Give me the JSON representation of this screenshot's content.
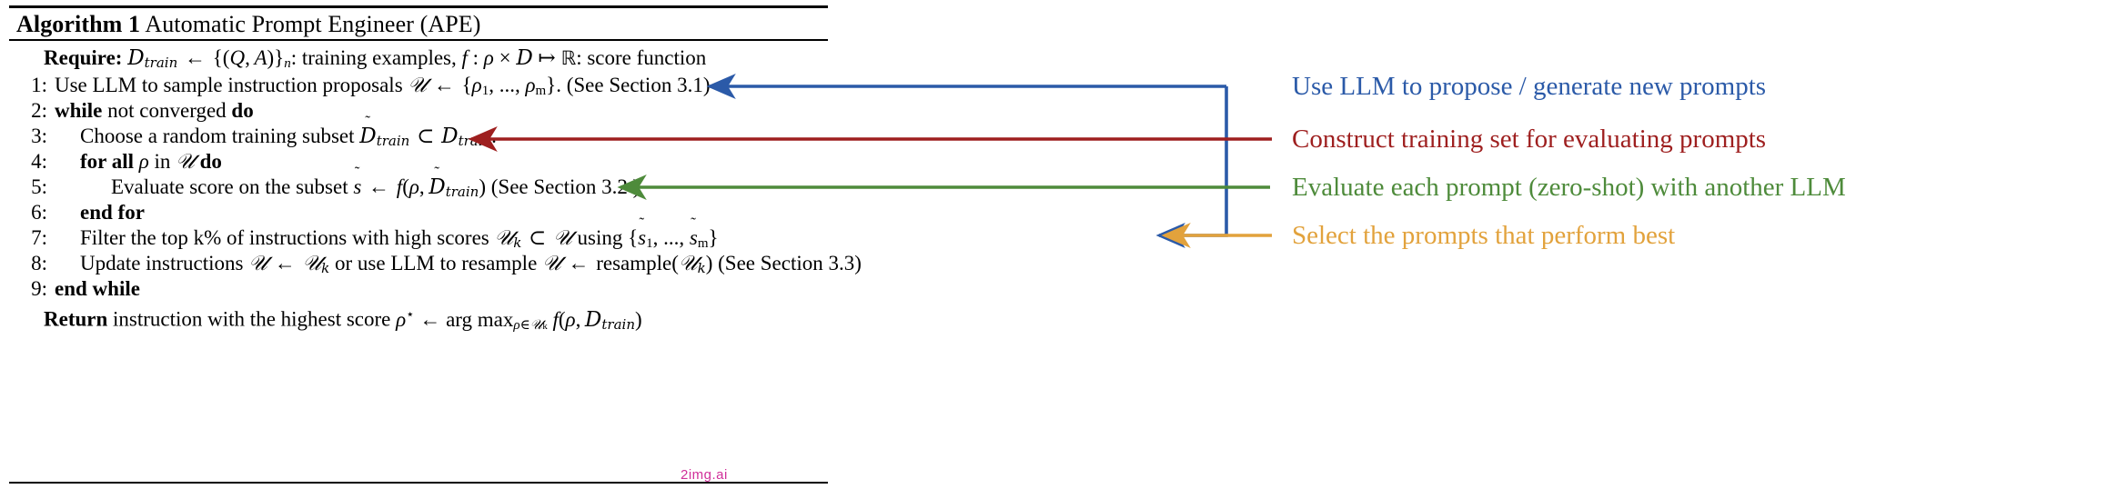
{
  "algorithm": {
    "title_prefix": "Algorithm 1",
    "title_text": "Automatic Prompt Engineer (APE)",
    "require_label": "Require:",
    "require_text_a": "training examples,",
    "require_text_b": ": score function",
    "require_sym_dtrain": "D",
    "require_sym_train_sub": "train",
    "require_arrow": "←",
    "require_set": "{(Q, A)}",
    "require_set_sub": "n",
    "require_colon": ":",
    "require_f": "f",
    "require_map": ": ρ ×",
    "require_D": "D",
    "require_mapsto": "↦",
    "require_R": "ℝ",
    "lines": [
      {
        "num": "1:",
        "indent": "i1",
        "text": "Use LLM to sample instruction proposals",
        "math": "U ← {ρ₁, ..., ρₘ}. (See Section 3.1)"
      },
      {
        "num": "2:",
        "indent": "i1",
        "text": "while not converged do",
        "math": ""
      },
      {
        "num": "3:",
        "indent": "i2",
        "text": "Choose a random training subset",
        "math": "D̃train ⊂ Dtrain."
      },
      {
        "num": "4:",
        "indent": "i2",
        "text": "for all ρ in U do",
        "math": ""
      },
      {
        "num": "5:",
        "indent": "i3",
        "text": "Evaluate score on the subset",
        "math": "s̃ ← f(ρ, D̃train) (See Section 3.2 )"
      },
      {
        "num": "6:",
        "indent": "i2",
        "text": "end for",
        "math": ""
      },
      {
        "num": "7:",
        "indent": "i2",
        "text": "Filter the top k% of instructions with high scores",
        "math": "Uk ⊂ U using {s̃₁, ..., s̃ₘ}"
      },
      {
        "num": "8:",
        "indent": "i2",
        "text": "Update instructions",
        "math": "U ← Uk or use LLM to resample U ← resample(Uk) (See Section 3.3)"
      },
      {
        "num": "9:",
        "indent": "i1",
        "text": "end while",
        "math": ""
      }
    ],
    "return_label": "Return",
    "return_text": "instruction with the highest score",
    "return_math": "ρ⋆ ← arg maxρ∈Uk f(ρ, Dtrain)"
  },
  "annotations": [
    {
      "id": "propose",
      "label": "Use LLM to propose / generate new prompts",
      "color": "#2b5aa8"
    },
    {
      "id": "construct",
      "label": "Construct training set for evaluating prompts",
      "color": "#9e1f1f"
    },
    {
      "id": "evaluate",
      "label": "Evaluate each prompt (zero-shot) with another LLM",
      "color": "#4e8b3b"
    },
    {
      "id": "select",
      "label": "Select the prompts that perform best",
      "color": "#e2a23c"
    }
  ],
  "watermark": {
    "text": "2img.ai",
    "color": "#d0309a"
  }
}
